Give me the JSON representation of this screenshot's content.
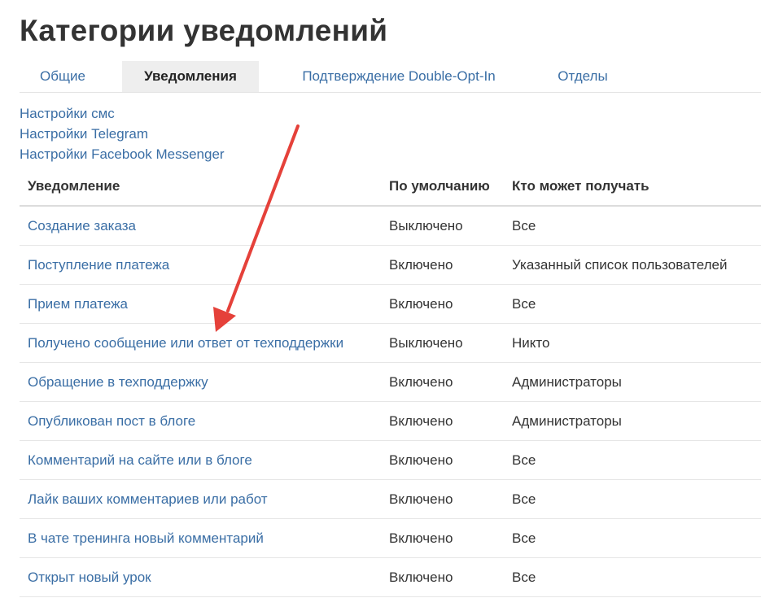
{
  "page": {
    "title": "Категории уведомлений"
  },
  "tabs": [
    {
      "label": "Общие",
      "active": false
    },
    {
      "label": "Уведомления",
      "active": true
    },
    {
      "label": "Подтверждение Double-Opt-In",
      "active": false
    },
    {
      "label": "Отделы",
      "active": false
    }
  ],
  "settings_links": [
    "Настройки смс",
    "Настройки Telegram",
    "Настройки Facebook Messenger"
  ],
  "table": {
    "headers": [
      "Уведомление",
      "По умолчанию",
      "Кто может получать"
    ],
    "rows": [
      [
        "Создание заказа",
        "Выключено",
        "Все"
      ],
      [
        "Поступление платежа",
        "Включено",
        "Указанный список пользователей"
      ],
      [
        "Прием платежа",
        "Включено",
        "Все"
      ],
      [
        "Получено сообщение или ответ от техподдержки",
        "Выключено",
        "Никто"
      ],
      [
        "Обращение в техподдержку",
        "Включено",
        "Администраторы"
      ],
      [
        "Опубликован пост в блоге",
        "Включено",
        "Администраторы"
      ],
      [
        "Комментарий на сайте или в блоге",
        "Включено",
        "Все"
      ],
      [
        "Лайк ваших комментариев или работ",
        "Включено",
        "Все"
      ],
      [
        "В чате тренинга новый комментарий",
        "Включено",
        "Все"
      ],
      [
        "Открыт новый урок",
        "Включено",
        "Все"
      ]
    ]
  },
  "colors": {
    "link": "#3a6ea5",
    "annotation_arrow": "#e5413a",
    "active_tab_bg": "#eeeeee"
  }
}
